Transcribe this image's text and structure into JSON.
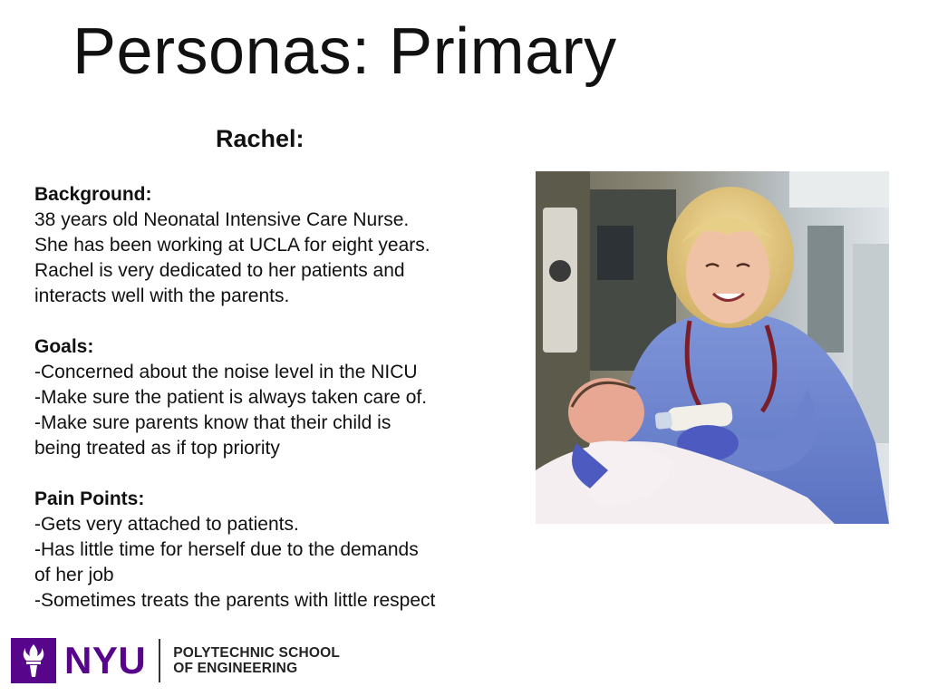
{
  "slide": {
    "title": "Personas: Primary",
    "persona_name": "Rachel:"
  },
  "background": {
    "heading": "Background:",
    "lines": [
      "38 years old Neonatal Intensive Care Nurse.",
      "She has been working at UCLA for eight years.",
      "Rachel is very dedicated to her patients and",
      "interacts well with the parents."
    ]
  },
  "goals": {
    "heading": "Goals:",
    "lines": [
      "-Concerned about the noise level in the NICU",
      "-Make sure the patient is always taken care of.",
      "-Make sure parents know that their child is",
      "being treated as if top priority"
    ]
  },
  "pain_points": {
    "heading": "Pain Points:",
    "lines": [
      "-Gets very attached to patients.",
      "-Has little time for herself due to the demands",
      "of her job",
      "-Sometimes treats the parents with little respect"
    ]
  },
  "footer": {
    "logo_text": "NYU",
    "school_line1": "POLYTECHNIC SCHOOL",
    "school_line2": "OF ENGINEERING",
    "brand_color": "#57068c"
  },
  "photo": {
    "icon": "nurse-feeding-baby-photo"
  }
}
